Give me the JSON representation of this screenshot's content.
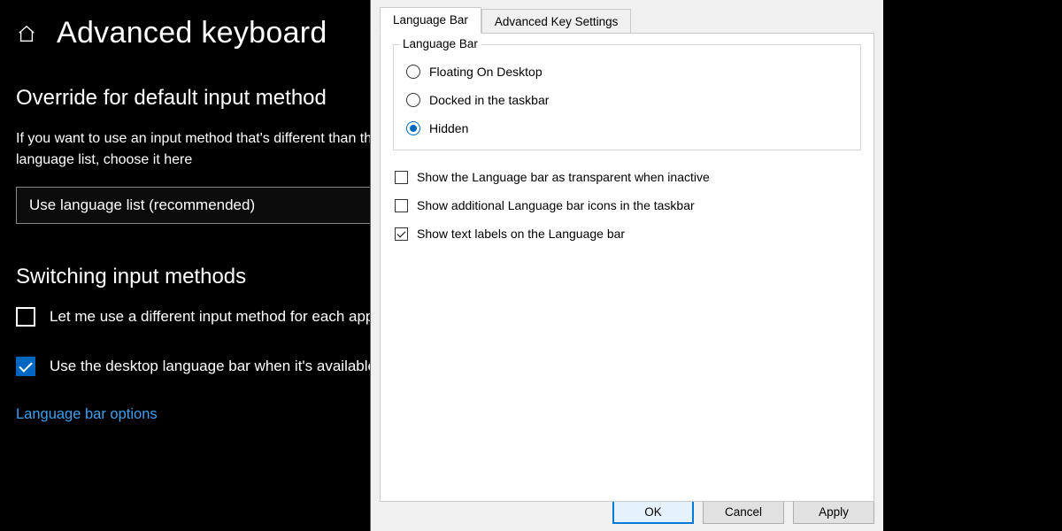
{
  "settings": {
    "title": "Advanced keyboard",
    "override": {
      "heading": "Override for default input method",
      "desc": "If you want to use an input method that's different than the first one in your language list, choose it here",
      "dropdown_value": "Use language list (recommended)"
    },
    "switching": {
      "heading": "Switching input methods",
      "cb_per_app": "Let me use a different input method for each app window",
      "cb_desktop_bar": "Use the desktop language bar when it's available"
    },
    "link_lang_bar_options": "Language bar options"
  },
  "dialog": {
    "tabs": {
      "language_bar": "Language Bar",
      "advanced_key": "Advanced Key Settings"
    },
    "group_title": "Language Bar",
    "radios": {
      "floating": "Floating On Desktop",
      "docked": "Docked in the taskbar",
      "hidden": "Hidden"
    },
    "checks": {
      "transparent": "Show the Language bar as transparent when inactive",
      "additional_icons": "Show additional Language bar icons in the taskbar",
      "text_labels": "Show text labels on the Language bar"
    },
    "buttons": {
      "ok": "OK",
      "cancel": "Cancel",
      "apply": "Apply"
    }
  }
}
